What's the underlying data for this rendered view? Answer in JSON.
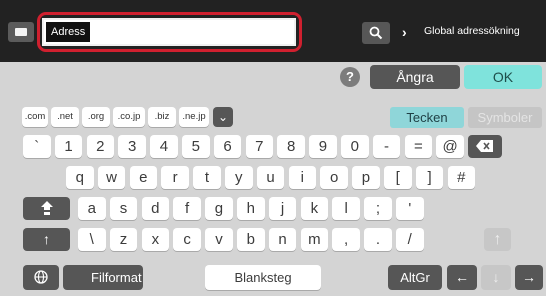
{
  "address": {
    "label": "Adress",
    "value": ""
  },
  "global_search": {
    "label": "Global adressökning"
  },
  "icons": {
    "menu": "menu-icon",
    "search": "search-icon",
    "chevron": "chevron-right-icon",
    "help": "help-icon"
  },
  "keyboard": {
    "help_label": "?",
    "undo_label": "Ångra",
    "ok_label": "OK",
    "domains": [
      ".com",
      ".net",
      ".org",
      ".co.jp",
      ".biz",
      ".ne.jp"
    ],
    "domain_more": "⌄",
    "tab_chars": "Tecken",
    "tab_symbols": "Symboler",
    "row1": [
      "`",
      "1",
      "2",
      "3",
      "4",
      "5",
      "6",
      "7",
      "8",
      "9",
      "0",
      "-",
      "=",
      "@"
    ],
    "row2": [
      "q",
      "w",
      "e",
      "r",
      "t",
      "y",
      "u",
      "i",
      "o",
      "p",
      "[",
      "]",
      "#"
    ],
    "row3": [
      "a",
      "s",
      "d",
      "f",
      "g",
      "h",
      "j",
      "k",
      "l",
      ";",
      "'"
    ],
    "row4": [
      "\\",
      "z",
      "x",
      "c",
      "v",
      "b",
      "n",
      "m",
      ",",
      ".",
      "/"
    ],
    "format_label": "Filformat",
    "space_label": "Blanksteg",
    "altgr_label": "AltGr",
    "left_arrow": "←",
    "down_arrow": "↓",
    "right_arrow": "→",
    "up_arrow": "↑"
  },
  "colors": {
    "accent": "#7fe3dc",
    "highlight": "#d0202f",
    "dark_key": "#565656"
  }
}
